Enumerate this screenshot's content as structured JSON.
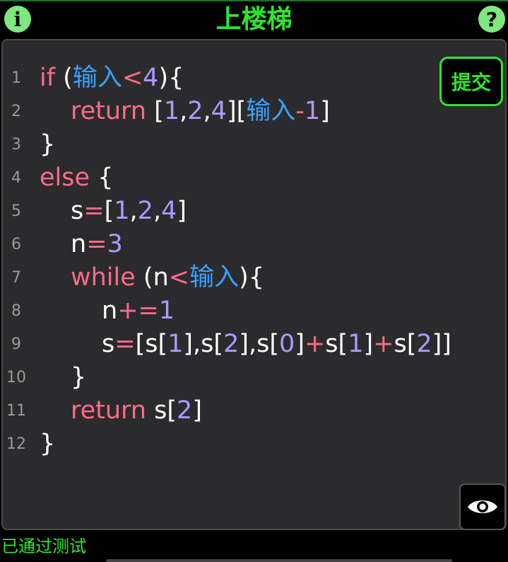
{
  "colors": {
    "accent_green": "#2ee52e",
    "keyword": "#ff6b8b",
    "variable": "#3aa0ff",
    "number": "#b098ff",
    "plain": "#ffffff"
  },
  "header": {
    "title": "上楼梯",
    "info_icon": "info-icon",
    "info_label": "i",
    "help_icon": "help-icon",
    "help_label": "?"
  },
  "editor": {
    "submit_label": "提交",
    "eye_icon": "eye-icon",
    "lines": [
      {
        "num": "1",
        "tokens": [
          [
            "if",
            "keyword"
          ],
          [
            " (",
            "plain"
          ],
          [
            "输入",
            "variable"
          ],
          [
            "<",
            "keyword"
          ],
          [
            "4",
            "number"
          ],
          [
            "){",
            "plain"
          ]
        ]
      },
      {
        "num": "2",
        "indent": 1,
        "tokens": [
          [
            "return",
            "keyword"
          ],
          [
            " [",
            "plain"
          ],
          [
            "1",
            "number"
          ],
          [
            ",",
            "plain"
          ],
          [
            "2",
            "number"
          ],
          [
            ",",
            "plain"
          ],
          [
            "4",
            "number"
          ],
          [
            "][",
            "plain"
          ],
          [
            "输入",
            "variable"
          ],
          [
            "-",
            "keyword"
          ],
          [
            "1",
            "number"
          ],
          [
            "]",
            "plain"
          ]
        ]
      },
      {
        "num": "3",
        "tokens": [
          [
            "}",
            "plain"
          ]
        ]
      },
      {
        "num": "4",
        "tokens": [
          [
            "else",
            "keyword"
          ],
          [
            " {",
            "plain"
          ]
        ]
      },
      {
        "num": "5",
        "indent": 1,
        "tokens": [
          [
            "s",
            "plain"
          ],
          [
            "=",
            "keyword"
          ],
          [
            "[",
            "plain"
          ],
          [
            "1",
            "number"
          ],
          [
            ",",
            "plain"
          ],
          [
            "2",
            "number"
          ],
          [
            ",",
            "plain"
          ],
          [
            "4",
            "number"
          ],
          [
            "]",
            "plain"
          ]
        ]
      },
      {
        "num": "6",
        "indent": 1,
        "tokens": [
          [
            "n",
            "plain"
          ],
          [
            "=",
            "keyword"
          ],
          [
            "3",
            "number"
          ]
        ]
      },
      {
        "num": "7",
        "indent": 1,
        "tokens": [
          [
            "while",
            "keyword"
          ],
          [
            " (",
            "plain"
          ],
          [
            "n",
            "plain"
          ],
          [
            "<",
            "keyword"
          ],
          [
            "输入",
            "variable"
          ],
          [
            "){",
            "plain"
          ]
        ]
      },
      {
        "num": "8",
        "indent": 2,
        "tokens": [
          [
            "n",
            "plain"
          ],
          [
            "+=",
            "keyword"
          ],
          [
            "1",
            "number"
          ]
        ]
      },
      {
        "num": "9",
        "indent": 2,
        "tokens": [
          [
            "s",
            "plain"
          ],
          [
            "=",
            "keyword"
          ],
          [
            "[s[",
            "plain"
          ],
          [
            "1",
            "number"
          ],
          [
            "],s[",
            "plain"
          ],
          [
            "2",
            "number"
          ],
          [
            "],s[",
            "plain"
          ],
          [
            "0",
            "number"
          ],
          [
            "]",
            "plain"
          ],
          [
            "+",
            "keyword"
          ],
          [
            "s[",
            "plain"
          ],
          [
            "1",
            "number"
          ],
          [
            "]",
            "plain"
          ],
          [
            "+",
            "keyword"
          ],
          [
            "s[",
            "plain"
          ],
          [
            "2",
            "number"
          ],
          [
            "]]",
            "plain"
          ]
        ]
      },
      {
        "num": "10",
        "indent": 1,
        "tokens": [
          [
            "}",
            "plain"
          ]
        ]
      },
      {
        "num": "11",
        "indent": 1,
        "tokens": [
          [
            "return",
            "keyword"
          ],
          [
            " s[",
            "plain"
          ],
          [
            "2",
            "number"
          ],
          [
            "]",
            "plain"
          ]
        ]
      },
      {
        "num": "12",
        "tokens": [
          [
            "}",
            "plain"
          ]
        ]
      }
    ]
  },
  "status": {
    "text": "已通过测试"
  }
}
